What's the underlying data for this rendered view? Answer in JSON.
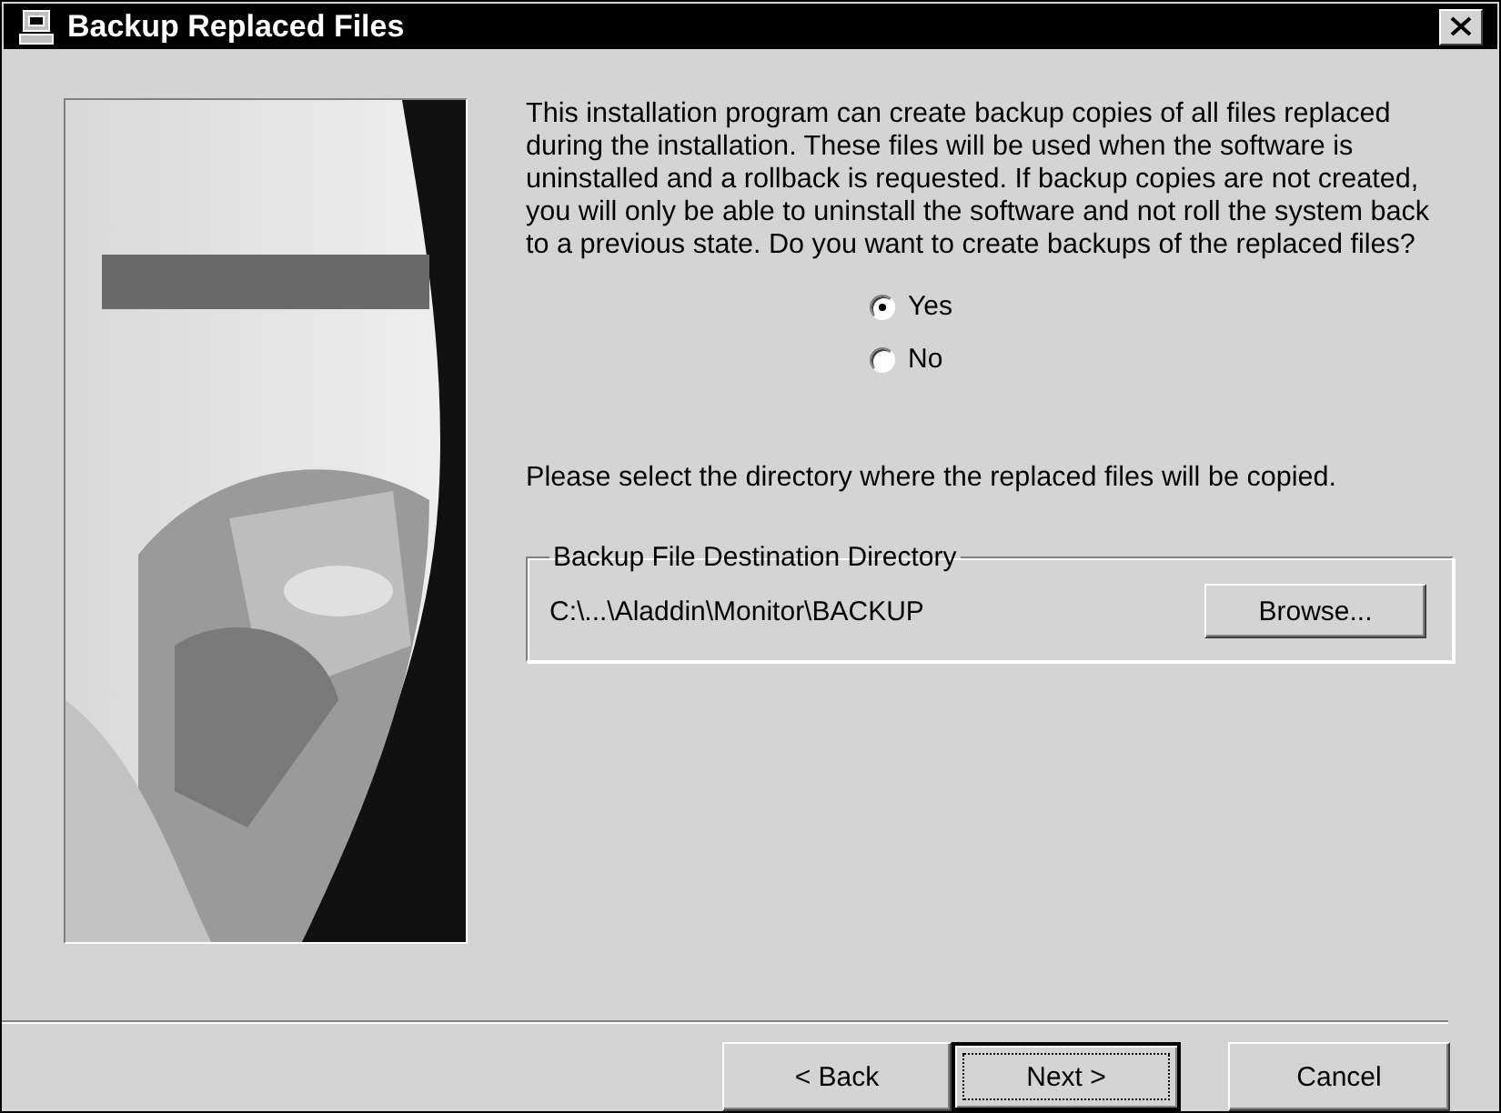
{
  "window": {
    "title": "Backup Replaced Files"
  },
  "description": "This installation program can create backup copies of all files replaced during the installation. These files will be used when the software is uninstalled and a rollback is requested.  If backup copies are not created, you will only be able to uninstall the software and not roll the system back to a previous state.  Do you want to create backups of the replaced files?",
  "options": [
    {
      "label": "Yes",
      "selected": true
    },
    {
      "label": "No",
      "selected": false
    }
  ],
  "directory_prompt": "Please select the directory where the replaced  files will be copied.",
  "destination": {
    "title": "Backup File Destination Directory",
    "path": "C:\\...\\Aladdin\\Monitor\\BACKUP",
    "button": "Browse..."
  },
  "buttons": [
    {
      "label": "< Back",
      "default": false
    },
    {
      "label": "Next >",
      "default": true
    },
    {
      "label": "Cancel",
      "default": false
    }
  ]
}
